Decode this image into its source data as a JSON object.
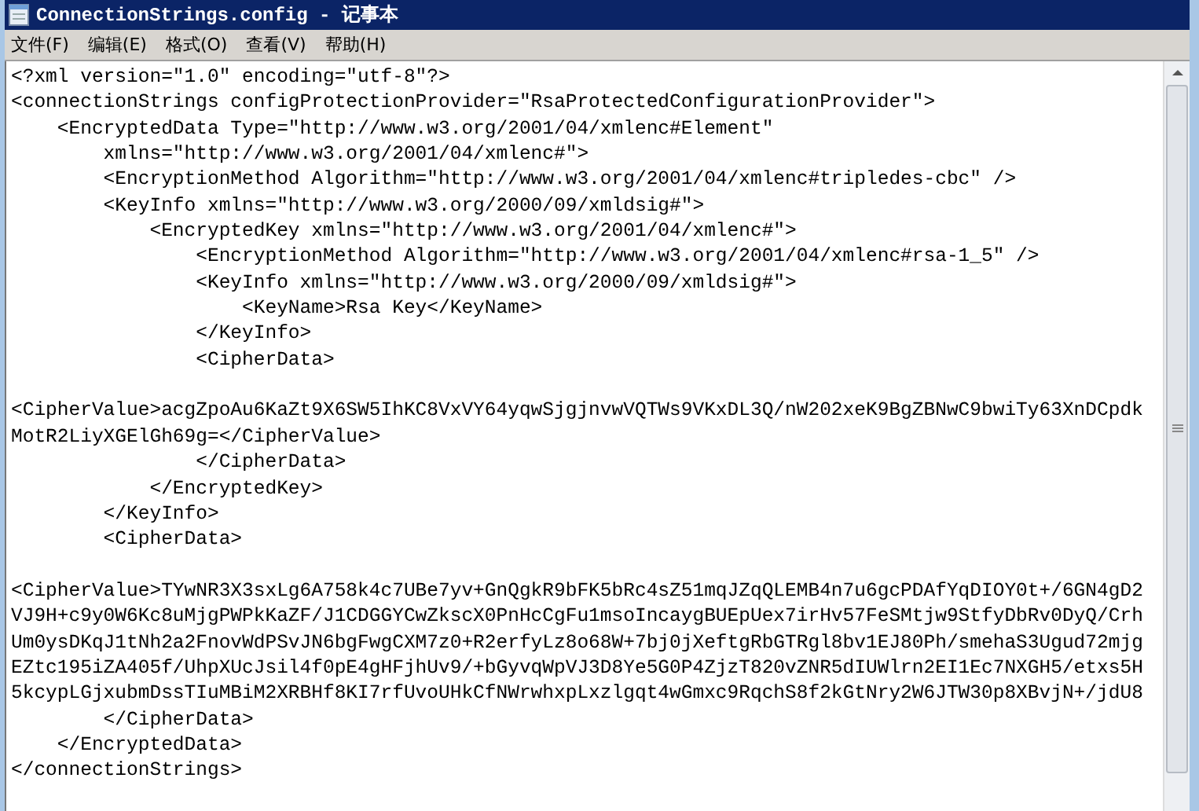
{
  "window": {
    "title": "ConnectionStrings.config - 记事本"
  },
  "menu": [
    "文件(F)",
    "编辑(E)",
    "格式(O)",
    "查看(V)",
    "帮助(H)"
  ],
  "editor": {
    "lines": [
      {
        "kind": "code",
        "text": "<?xml version=\"1.0\" encoding=\"utf-8\"?>"
      },
      {
        "kind": "code",
        "text": "<connectionStrings configProtectionProvider=\"RsaProtectedConfigurationProvider\">"
      },
      {
        "kind": "code",
        "text": "    <EncryptedData Type=\"http://www.w3.org/2001/04/xmlenc#Element\""
      },
      {
        "kind": "code",
        "text": "        xmlns=\"http://www.w3.org/2001/04/xmlenc#\">"
      },
      {
        "kind": "code",
        "text": "        <EncryptionMethod Algorithm=\"http://www.w3.org/2001/04/xmlenc#tripledes-cbc\" />"
      },
      {
        "kind": "code",
        "text": "        <KeyInfo xmlns=\"http://www.w3.org/2000/09/xmldsig#\">"
      },
      {
        "kind": "code",
        "text": "            <EncryptedKey xmlns=\"http://www.w3.org/2001/04/xmlenc#\">"
      },
      {
        "kind": "code",
        "text": "                <EncryptionMethod Algorithm=\"http://www.w3.org/2001/04/xmlenc#rsa-1_5\" />"
      },
      {
        "kind": "code",
        "text": "                <KeyInfo xmlns=\"http://www.w3.org/2000/09/xmldsig#\">"
      },
      {
        "kind": "code",
        "text": "                    <KeyName>Rsa Key</KeyName>"
      },
      {
        "kind": "code",
        "text": "                </KeyInfo>"
      },
      {
        "kind": "code",
        "text": "                <CipherData>"
      },
      {
        "kind": "blank"
      },
      {
        "kind": "code",
        "text": "<CipherValue>acgZpoAu6KaZt9X6SW5IhKC8VxVY64yqwSjgjnvwVQTWs9VKxDL3Q/nW202xeK9BgZBNwC9bwiTy63XnDCpdk"
      },
      {
        "kind": "code",
        "text": "MotR2LiyXGElGh69g=</CipherValue>"
      },
      {
        "kind": "code",
        "text": "                </CipherData>"
      },
      {
        "kind": "code",
        "text": "            </EncryptedKey>"
      },
      {
        "kind": "code",
        "text": "        </KeyInfo>"
      },
      {
        "kind": "code",
        "text": "        <CipherData>"
      },
      {
        "kind": "blank"
      },
      {
        "kind": "code",
        "text": "<CipherValue>TYwNR3X3sxLg6A758k4c7UBe7yv+GnQgkR9bFK5bRc4sZ51mqJZqQLEMB4n7u6gcPDAfYqDIOY0t+/6GN4gD2"
      },
      {
        "kind": "code",
        "text": "VJ9H+c9y0W6Kc8uMjgPWPkKaZF/J1CDGGYCwZkscX0PnHcCgFu1msoIncaygBUEpUex7irHv57FeSMtjw9StfyDbRv0DyQ/Crh"
      },
      {
        "kind": "code",
        "text": "Um0ysDKqJ1tNh2a2FnovWdPSvJN6bgFwgCXM7z0+R2erfyLz8o68W+7bj0jXeftgRbGTRgl8bv1EJ80Ph/smehaS3Ugud72mjg"
      },
      {
        "kind": "code",
        "text": "EZtc195iZA405f/UhpXUcJsil4f0pE4gHFjhUv9/+bGyvqWpVJ3D8Ye5G0P4ZjzT820vZNR5dIUWlrn2EI1Ec7NXGH5/etxs5H"
      },
      {
        "kind": "code",
        "text": "5kcypLGjxubmDssTIuMBiM2XRBHf8KI7rfUvoUHkCfNWrwhxpLxzlgqt4wGmxc9RqchS8f2kGtNry2W6JTW30p8XBvjN+/jdU8"
      },
      {
        "kind": "code",
        "text": "        </CipherData>"
      },
      {
        "kind": "code",
        "text": "    </EncryptedData>"
      },
      {
        "kind": "code",
        "text": "</connectionStrings>"
      }
    ]
  }
}
